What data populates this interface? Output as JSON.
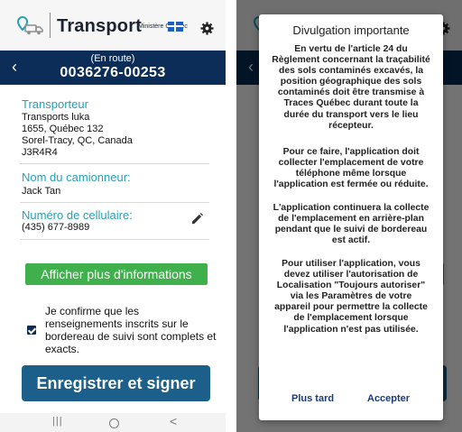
{
  "app": {
    "title": "Transport",
    "ministry": "Ministère Québec"
  },
  "header": {
    "status": "(En route)",
    "number": "0036276-00253"
  },
  "transporter": {
    "label": "Transporteur",
    "lines": [
      "Transports luka",
      "1655, Québec 132",
      "Sorel-Tracy, QC, Canada",
      "J3R4R4"
    ]
  },
  "driver": {
    "label": "Nom du camionneur:",
    "value": "Jack Tan"
  },
  "phone": {
    "label": "Numéro de cellulaire:",
    "value": "(435) 677-8989"
  },
  "more_info_label": "Afficher plus d'informations",
  "confirm": {
    "checked": true,
    "text": "Je confirme que les renseignements inscrits sur le bordereau de suivi sont complets et exacts."
  },
  "sign_label": "Enregistrer et signer",
  "dialog": {
    "title": "Divulgation importante",
    "paragraphs": [
      "En vertu de l'article 24 du Règlement concernant la traçabilité des sols contaminés excavés, la position géographique des sols contaminés doit être transmise à Traces Québec durant toute la durée du transport vers le lieu récepteur.",
      "Pour ce faire, l'application doit collecter l'emplacement de votre téléphone même lorsque l'application est fermée ou réduite.",
      "L'application continuera la collecte de l'emplacement en arrière-plan pendant que le suivi de bordereau est actif.",
      "Pour utiliser l'application, vous devez utiliser l'autorisation de Localisation \"Toujours autoriser\" via les Paramètres de votre appareil pour permettre la collecte de l'emplacement lorsque l'application n'est pas utilisée."
    ],
    "cancel_label": "Plus tard",
    "accept_label": "Accepter"
  },
  "nav": {
    "recent": "|||",
    "back": "<"
  },
  "colors": {
    "navy": "#0b2d57",
    "teal": "#26a0b5",
    "green": "#3fb04b",
    "sign_blue": "#1c5f8a",
    "dialog_button": "#1c3a75"
  },
  "icons": [
    "truck-location-logo-icon",
    "quebec-flag-icon",
    "settings-gear-icon",
    "back-arrow-icon",
    "pencil-edit-icon",
    "checkbox-checked-icon"
  ]
}
